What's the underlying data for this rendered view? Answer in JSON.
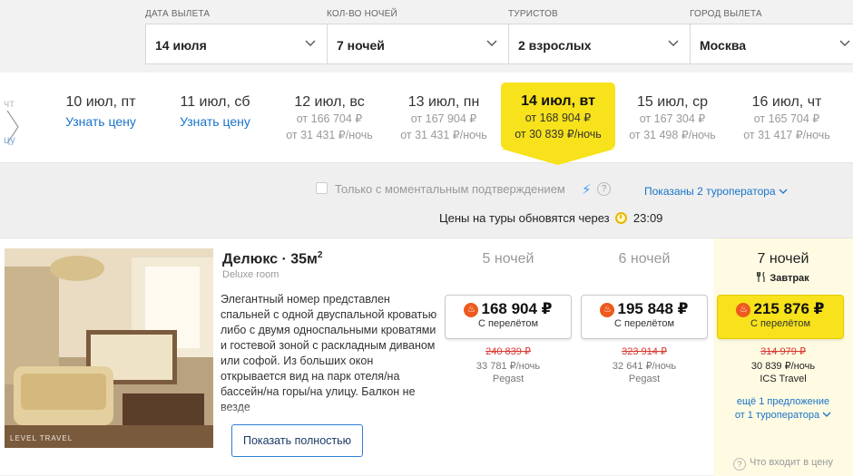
{
  "search": {
    "fields": [
      {
        "label": "ДАТА ВЫЛЕТА",
        "value": "14 июля"
      },
      {
        "label": "КОЛ-ВО НОЧЕЙ",
        "value": "7 ночей"
      },
      {
        "label": "ТУРИСТОВ",
        "value": "2 взрослых"
      },
      {
        "label": "ГОРОД ВЫЛЕТА",
        "value": "Москва"
      }
    ]
  },
  "dates": [
    {
      "title": "10 июл, пт",
      "link": "Узнать цену"
    },
    {
      "title": "11 июл, сб",
      "link": "Узнать цену"
    },
    {
      "title": "12 июл, вс",
      "price": "от 166 704 ₽",
      "per_night": "от 31 431 ₽/ночь"
    },
    {
      "title": "13 июл, пн",
      "price": "от 167 904 ₽",
      "per_night": "от 31 431 ₽/ночь"
    },
    {
      "title": "14 июл, вт",
      "price": "от 168 904 ₽",
      "per_night": "от 30 839 ₽/ночь",
      "selected": true
    },
    {
      "title": "15 июл, ср",
      "price": "от 167 304 ₽",
      "per_night": "от 31 498 ₽/ночь"
    },
    {
      "title": "16 июл, чт",
      "price": "от 165 704 ₽",
      "per_night": "от 31 417 ₽/ночь"
    }
  ],
  "filters": {
    "instant_label": "Только с моментальным подтверждением",
    "operators_link": "Показаны 2 туроператора",
    "update_text": "Цены на туры обновятся через",
    "timer": "23:09"
  },
  "room": {
    "title": "Делюкс · 35м",
    "title_sup": "2",
    "subtitle": "Deluxe room",
    "description": "Элегантный номер представлен спальней с одной двуспальной кроватью либо с двумя односпальными кроватями и гостевой зоной с раскладным диваном или софой. Из больших окон открывается вид на парк отеля/на бассейн/на горы/на улицу. Балкон не везде",
    "show_more": "Показать полностью",
    "photo_watermark": "LEVEL TRAVEL"
  },
  "offers": [
    {
      "nights": "5 ночей",
      "price": "168 904 ₽",
      "flight": "С перелётом",
      "old_price": "240 839 ₽",
      "per_night": "33 781 ₽/ночь",
      "operator": "Pegast"
    },
    {
      "nights": "6 ночей",
      "price": "195 848 ₽",
      "flight": "С перелётом",
      "old_price": "323 914 ₽",
      "per_night": "32 641 ₽/ночь",
      "operator": "Pegast"
    },
    {
      "nights": "7 ночей",
      "meal": "Завтрак",
      "price": "215 876 ₽",
      "flight": "С перелётом",
      "old_price": "314 979 ₽",
      "per_night": "30 839 ₽/ночь",
      "operator": "ICS Travel",
      "more_line1": "ещё 1 предложение",
      "more_line2": "от 1 туроператора",
      "included": "Что входит в цену"
    }
  ],
  "colors": {
    "accent_yellow": "#f7e21b",
    "link_blue": "#1a73c8",
    "old_price_red": "#d9362f"
  }
}
